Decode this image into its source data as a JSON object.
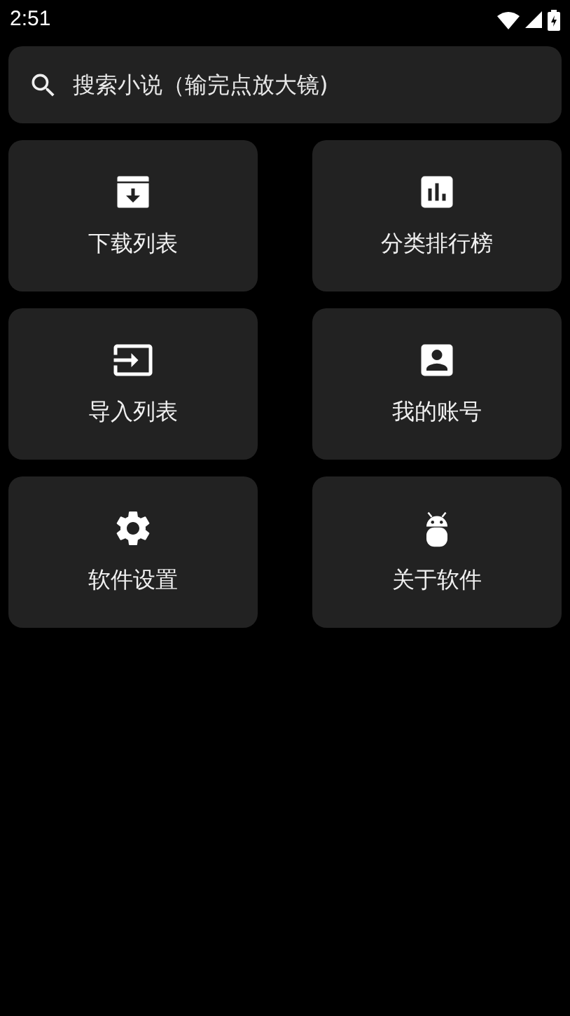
{
  "status_bar": {
    "time": "2:51"
  },
  "search": {
    "placeholder": "搜索小说（输完点放大镜)"
  },
  "tiles": [
    {
      "kind": "download",
      "label": "下载列表"
    },
    {
      "kind": "chart",
      "label": "分类排行榜"
    },
    {
      "kind": "import",
      "label": "导入列表"
    },
    {
      "kind": "account",
      "label": "我的账号"
    },
    {
      "kind": "settings",
      "label": "软件设置"
    },
    {
      "kind": "android",
      "label": "关于软件"
    }
  ]
}
